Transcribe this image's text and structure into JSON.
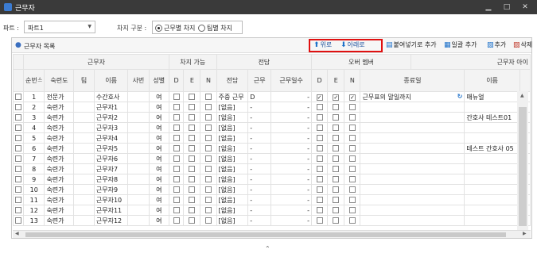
{
  "window": {
    "title": "근무자"
  },
  "filter": {
    "part_label": "파트 :",
    "part_value": "파트1",
    "mode_label": "차지 구분 :",
    "mode_options": [
      {
        "label": "근무별 차지",
        "selected": true
      },
      {
        "label": "팀별 차지",
        "selected": false
      }
    ]
  },
  "panel": {
    "title": "근무자 목록",
    "toolbar": {
      "up": "위로",
      "down": "아래로",
      "paste_add": "붙여넣기로 추가",
      "bulk_add": "일괄 추가",
      "add": "추가",
      "delete": "삭제"
    }
  },
  "grid": {
    "group_headers": [
      "근무자",
      "차지 가능",
      "전담",
      "오버 멤버",
      "근무자 아이"
    ],
    "headers": [
      "순번",
      "숙련도",
      "팀",
      "이름",
      "사번",
      "성별",
      "D",
      "E",
      "N",
      "전담",
      "근무",
      "근무일수",
      "D",
      "E",
      "N",
      "종료일",
      "이름",
      ""
    ],
    "sort_glyph": "≙",
    "rows": [
      {
        "no": "1",
        "level": "전문가",
        "team": "",
        "name": "수간호사",
        "emp": "",
        "sex": "여",
        "dd": false,
        "de": false,
        "dn": false,
        "ded": "주중 근무",
        "work": "D",
        "days": "-",
        "od": true,
        "oe": true,
        "on": true,
        "end": "근무표의 말일까지",
        "icon": "↻",
        "oname": "매뉴얼",
        "extra": "m"
      },
      {
        "no": "2",
        "level": "숙련가",
        "team": "",
        "name": "근무자1",
        "emp": "",
        "sex": "여",
        "dd": false,
        "de": false,
        "dn": false,
        "ded": "[없음]",
        "work": "-",
        "days": "-",
        "od": false,
        "oe": false,
        "on": false,
        "end": "",
        "icon": "",
        "oname": "",
        "extra": ""
      },
      {
        "no": "3",
        "level": "숙련가",
        "team": "",
        "name": "근무자2",
        "emp": "",
        "sex": "여",
        "dd": false,
        "de": false,
        "dn": false,
        "ded": "[없음]",
        "work": "-",
        "days": "-",
        "od": false,
        "oe": false,
        "on": false,
        "end": "",
        "icon": "",
        "oname": "간호사 테스트01",
        "extra": "te"
      },
      {
        "no": "4",
        "level": "숙련가",
        "team": "",
        "name": "근무자3",
        "emp": "",
        "sex": "여",
        "dd": false,
        "de": false,
        "dn": false,
        "ded": "[없음]",
        "work": "-",
        "days": "-",
        "od": false,
        "oe": false,
        "on": false,
        "end": "",
        "icon": "",
        "oname": "",
        "extra": ""
      },
      {
        "no": "5",
        "level": "숙련가",
        "team": "",
        "name": "근무자4",
        "emp": "",
        "sex": "여",
        "dd": false,
        "de": false,
        "dn": false,
        "ded": "[없음]",
        "work": "-",
        "days": "-",
        "od": false,
        "oe": false,
        "on": false,
        "end": "",
        "icon": "",
        "oname": "",
        "extra": ""
      },
      {
        "no": "6",
        "level": "숙련가",
        "team": "",
        "name": "근무자5",
        "emp": "",
        "sex": "여",
        "dd": false,
        "de": false,
        "dn": false,
        "ded": "[없음]",
        "work": "-",
        "days": "-",
        "od": false,
        "oe": false,
        "on": false,
        "end": "",
        "icon": "",
        "oname": "테스트 간호사 05",
        "extra": "te"
      },
      {
        "no": "7",
        "level": "숙련가",
        "team": "",
        "name": "근무자6",
        "emp": "",
        "sex": "여",
        "dd": false,
        "de": false,
        "dn": false,
        "ded": "[없음]",
        "work": "-",
        "days": "-",
        "od": false,
        "oe": false,
        "on": false,
        "end": "",
        "icon": "",
        "oname": "",
        "extra": ""
      },
      {
        "no": "8",
        "level": "숙련가",
        "team": "",
        "name": "근무자7",
        "emp": "",
        "sex": "여",
        "dd": false,
        "de": false,
        "dn": false,
        "ded": "[없음]",
        "work": "-",
        "days": "-",
        "od": false,
        "oe": false,
        "on": false,
        "end": "",
        "icon": "",
        "oname": "",
        "extra": ""
      },
      {
        "no": "9",
        "level": "숙련가",
        "team": "",
        "name": "근무자8",
        "emp": "",
        "sex": "여",
        "dd": false,
        "de": false,
        "dn": false,
        "ded": "[없음]",
        "work": "-",
        "days": "-",
        "od": false,
        "oe": false,
        "on": false,
        "end": "",
        "icon": "",
        "oname": "",
        "extra": ""
      },
      {
        "no": "10",
        "level": "숙련가",
        "team": "",
        "name": "근무자9",
        "emp": "",
        "sex": "여",
        "dd": false,
        "de": false,
        "dn": false,
        "ded": "[없음]",
        "work": "-",
        "days": "-",
        "od": false,
        "oe": false,
        "on": false,
        "end": "",
        "icon": "",
        "oname": "",
        "extra": ""
      },
      {
        "no": "11",
        "level": "숙련가",
        "team": "",
        "name": "근무자10",
        "emp": "",
        "sex": "여",
        "dd": false,
        "de": false,
        "dn": false,
        "ded": "[없음]",
        "work": "-",
        "days": "-",
        "od": false,
        "oe": false,
        "on": false,
        "end": "",
        "icon": "",
        "oname": "",
        "extra": ""
      },
      {
        "no": "12",
        "level": "숙련가",
        "team": "",
        "name": "근무자11",
        "emp": "",
        "sex": "여",
        "dd": false,
        "de": false,
        "dn": false,
        "ded": "[없음]",
        "work": "-",
        "days": "-",
        "od": false,
        "oe": false,
        "on": false,
        "end": "",
        "icon": "",
        "oname": "",
        "extra": ""
      },
      {
        "no": "13",
        "level": "숙련가",
        "team": "",
        "name": "근무자12",
        "emp": "",
        "sex": "여",
        "dd": false,
        "de": false,
        "dn": false,
        "ded": "[없음]",
        "work": "-",
        "days": "-",
        "od": false,
        "oe": false,
        "on": false,
        "end": "",
        "icon": "",
        "oname": "",
        "extra": ""
      }
    ]
  }
}
